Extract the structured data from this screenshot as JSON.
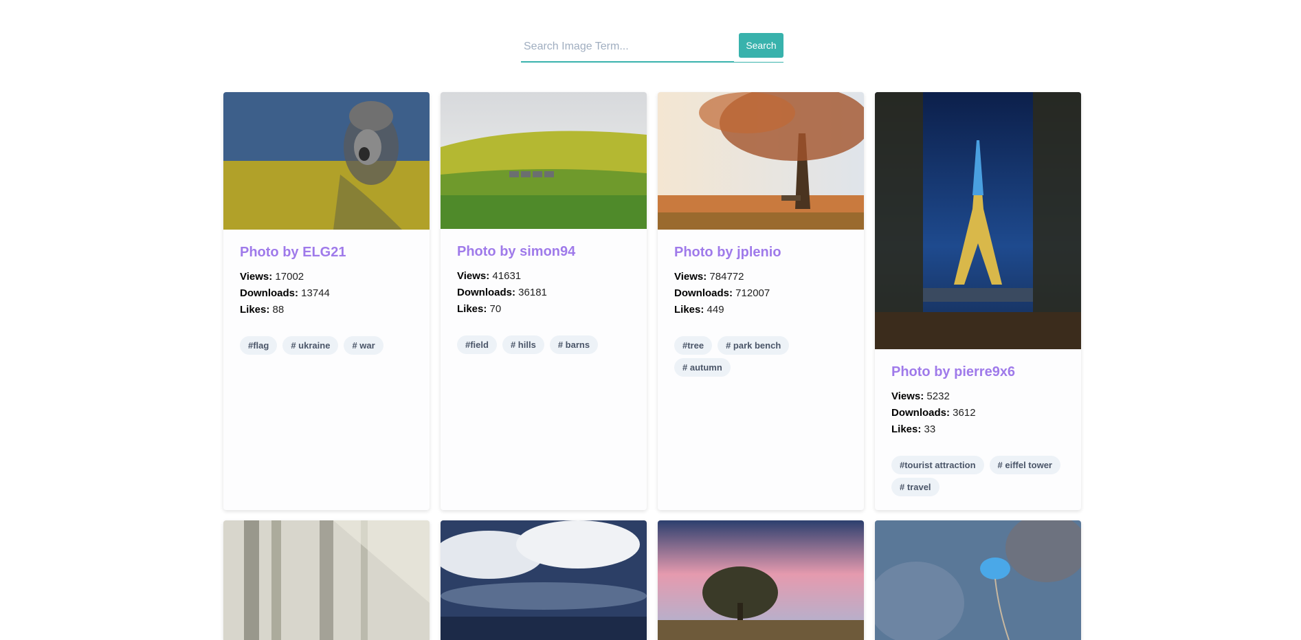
{
  "search": {
    "placeholder": "Search Image Term...",
    "value": "",
    "button_label": "Search"
  },
  "labels": {
    "views": "Views:",
    "downloads": "Downloads:",
    "likes": "Likes:"
  },
  "cards": [
    {
      "title": "Photo by ELG21",
      "views": "17002",
      "downloads": "13744",
      "likes": "88",
      "tags": [
        "#flag",
        "# ukraine",
        "# war"
      ],
      "image": "soldier-ukraine-flag"
    },
    {
      "title": "Photo by simon94",
      "views": "41631",
      "downloads": "36181",
      "likes": "70",
      "tags": [
        "#field",
        "# hills",
        "# barns"
      ],
      "image": "green-field-barns"
    },
    {
      "title": "Photo by jplenio",
      "views": "784772",
      "downloads": "712007",
      "likes": "449",
      "tags": [
        "#tree",
        "# park bench",
        "# autumn"
      ],
      "image": "autumn-tree-bench"
    },
    {
      "title": "Photo by pierre9x6",
      "views": "5232",
      "downloads": "3612",
      "likes": "33",
      "tags": [
        "#tourist attraction",
        "# eiffel tower",
        "# travel"
      ],
      "image": "eiffel-tower-night"
    }
  ],
  "second_row_images": [
    "foggy-forest",
    "storm-clouds",
    "pink-sky-tree",
    "blue-flower"
  ]
}
